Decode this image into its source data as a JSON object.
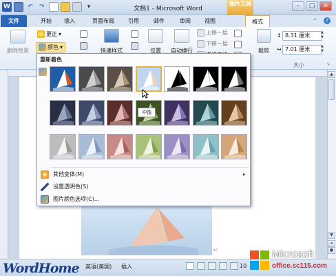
{
  "window": {
    "title": "文档1 - Microsoft Word",
    "context_tab": "图片工具",
    "min_glyph": "–",
    "max_glyph": "□",
    "close_glyph": "✕",
    "qat_word_icon": "W",
    "qat_save_icon": "save-icon",
    "qat_undo_glyph": "↶",
    "qat_redo_glyph": "↷"
  },
  "tabs": [
    "文件",
    "开始",
    "插入",
    "页面布局",
    "引用",
    "邮件",
    "审阅",
    "视图",
    "格式"
  ],
  "ribbon": {
    "remove_bg": "删除背景",
    "corrections": "更正",
    "color": "颜色",
    "quick_styles": "快速样式",
    "position": "位置",
    "wrap_text": "自动换行",
    "bring_forward": "上移一层",
    "send_backward": "下移一层",
    "selection_pane": "选择窗格",
    "crop": "裁剪",
    "height_value": "8.31 厘米",
    "width_value": "7.01 厘米",
    "size_group": "大小",
    "spin_up": "▲",
    "spin_down": "▼",
    "dropdown_arrow": "▾"
  },
  "dropdown": {
    "header": "重新着色",
    "tooltip": "冲蚀",
    "menu_items": [
      {
        "label": "其他变体(M)",
        "arrow": "▸",
        "icon": "palette-icon"
      },
      {
        "label": "设置透明色(S)",
        "arrow": "",
        "icon": "pen-icon"
      },
      {
        "label": "图片颜色选项(C)...",
        "arrow": "",
        "icon": "picture-color-icon"
      }
    ],
    "swatch_rows": [
      [
        {
          "bg": "#1f5ea7",
          "fg": "#ffffff",
          "accent": "#e05a1c"
        },
        {
          "bg": "#4b4b4b",
          "fg": "#cfcfcf",
          "accent": "#9c9c9c"
        },
        {
          "bg": "#5a5046",
          "fg": "#d8cbb5",
          "accent": "#a8937a"
        },
        {
          "bg": "#bfd7ee",
          "fg": "#ffffff",
          "accent": "#f1d2b8"
        },
        {
          "bg": "#ffffff",
          "fg": "#000000",
          "accent": "#000000"
        },
        {
          "bg": "#000000",
          "fg": "#ffffff",
          "accent": "#ffffff"
        },
        {
          "bg": "#000000",
          "fg": "#ffffff",
          "accent": "#6d6d6d"
        }
      ],
      [
        {
          "bg": "#293045",
          "fg": "#9aa6c0",
          "accent": "#647090"
        },
        {
          "bg": "#3d4a68",
          "fg": "#c4cee3",
          "accent": "#8393b6"
        },
        {
          "bg": "#5b2e2c",
          "fg": "#e0b7b2",
          "accent": "#a8716c"
        },
        {
          "bg": "#3f5226",
          "fg": "#c7d8a9",
          "accent": "#889e60"
        },
        {
          "bg": "#3f3260",
          "fg": "#c8bce3",
          "accent": "#8474b1"
        },
        {
          "bg": "#24494f",
          "fg": "#acd3d8",
          "accent": "#65979e"
        },
        {
          "bg": "#64401f",
          "fg": "#e6c7a5",
          "accent": "#b3845a"
        }
      ],
      [
        {
          "bg": "#bdbdbd",
          "fg": "#f4f4f4",
          "accent": "#9a9a9a"
        },
        {
          "bg": "#a8bcd6",
          "fg": "#f0f4fa",
          "accent": "#7d96b9"
        },
        {
          "bg": "#c88a86",
          "fg": "#f6e5e3",
          "accent": "#a8625d"
        },
        {
          "bg": "#a9c279",
          "fg": "#eef5e1",
          "accent": "#86a152"
        },
        {
          "bg": "#9c8fc3",
          "fg": "#ece8f6",
          "accent": "#7a6ba9"
        },
        {
          "bg": "#8fc0c8",
          "fg": "#e8f4f6",
          "accent": "#6aa0a9"
        },
        {
          "bg": "#d4a77a",
          "fg": "#f8ecdf",
          "accent": "#b8834d"
        }
      ]
    ]
  },
  "status": {
    "lang": "英语(美国)",
    "mode": "插入",
    "zoom": "10"
  },
  "watermark": {
    "left_logo": "WordHome",
    "ms_name": "Microsoft",
    "ms_url": "office.sc115.com"
  }
}
